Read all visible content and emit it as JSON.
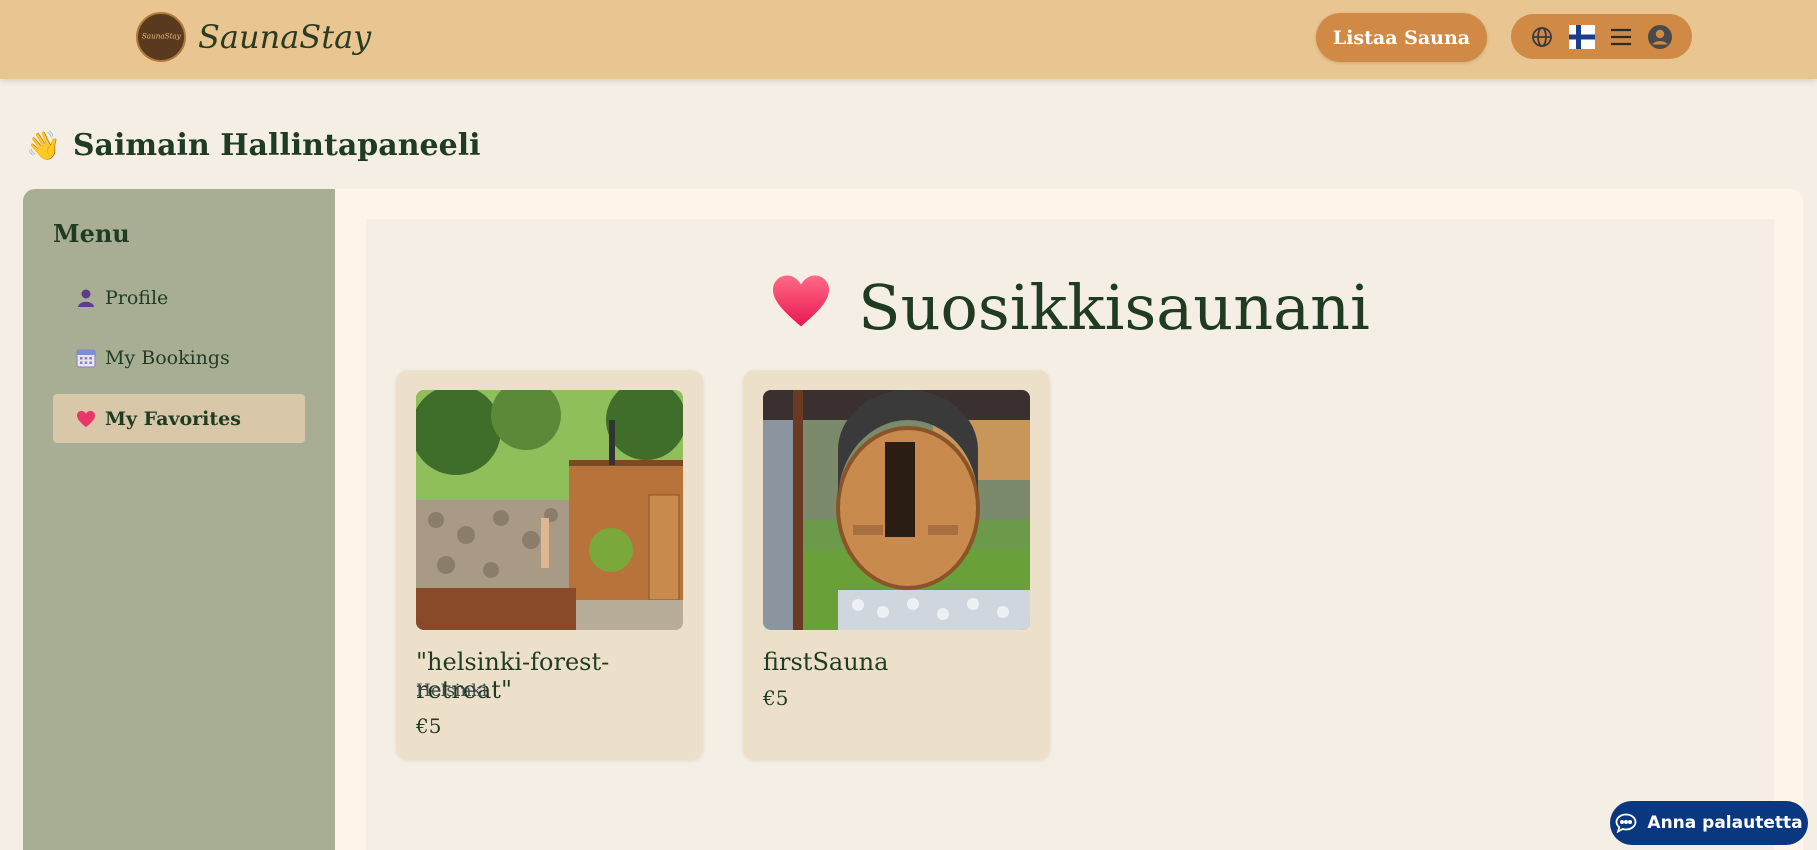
{
  "header": {
    "logo_text": "SaunaStay",
    "brand": "SaunaStay",
    "list_button": "Listaa Sauna",
    "icons": [
      "globe-icon",
      "finland-flag-icon",
      "hamburger-menu-icon",
      "user-account-icon"
    ]
  },
  "page": {
    "title_emoji": "👋",
    "title": "Saimain Hallintapaneeli"
  },
  "sidebar": {
    "title": "Menu",
    "items": [
      {
        "label": "Profile",
        "icon": "person-icon"
      },
      {
        "label": "My Bookings",
        "icon": "calendar-icon"
      },
      {
        "label": "My Favorites",
        "icon": "heart-icon",
        "active": true
      }
    ]
  },
  "favorites": {
    "title": "Suosikkisaunani",
    "cards": [
      {
        "name": "\"helsinki-forest-retreat\"",
        "city": "Helsinki",
        "price": "€5"
      },
      {
        "name": "firstSauna",
        "city": "",
        "price": "€5"
      }
    ]
  },
  "feedback": {
    "label": "Anna palautetta"
  },
  "colors": {
    "header_bg": "#e9c591",
    "accent": "#d08a45",
    "sidebar_bg": "#a8ae93",
    "active_item_bg": "#d8c7a9",
    "feedback_bg": "#0a3880",
    "text": "#1f3b22"
  }
}
